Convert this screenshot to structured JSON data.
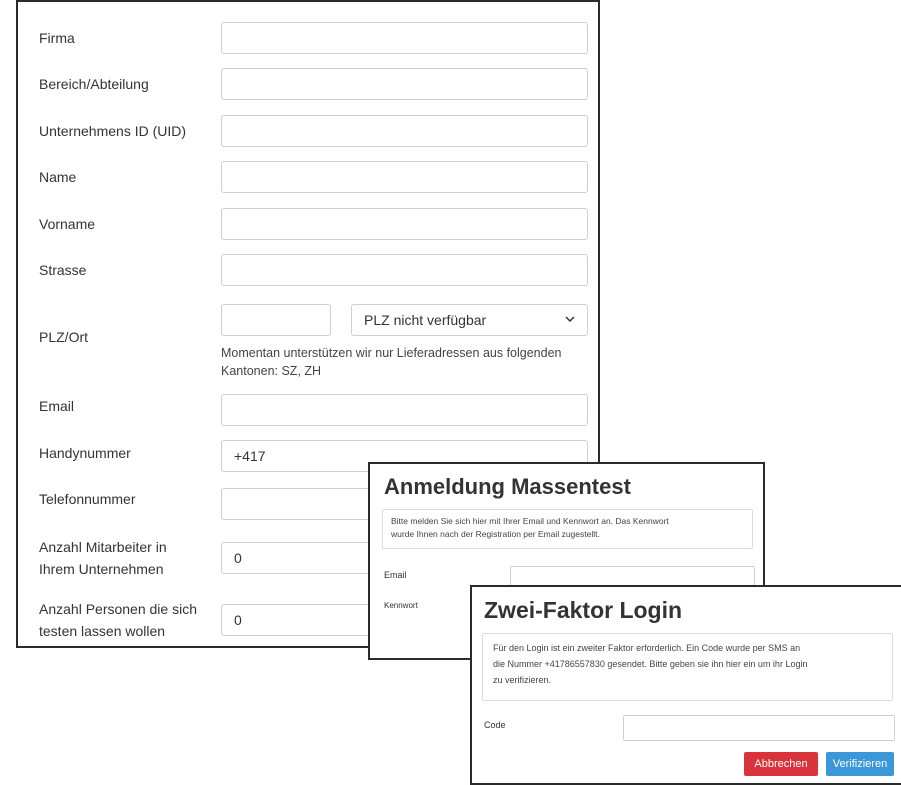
{
  "registration": {
    "fields": [
      {
        "label": "Firma",
        "value": ""
      },
      {
        "label": "Bereich/Abteilung",
        "value": ""
      },
      {
        "label": "Unternehmens ID (UID)",
        "value": ""
      },
      {
        "label": "Name",
        "value": ""
      },
      {
        "label": "Vorname",
        "value": ""
      },
      {
        "label": "Strasse",
        "value": ""
      }
    ],
    "plz_ort": {
      "label": "PLZ/Ort",
      "plz_value": "",
      "select_value": "PLZ nicht verfügbar",
      "help_line1": "Momentan unterstützen wir nur Lieferadressen aus folgenden",
      "help_line2": "Kantonen: SZ, ZH"
    },
    "email": {
      "label": "Email",
      "value": ""
    },
    "handynummer": {
      "label": "Handynummer",
      "value": "+417"
    },
    "telefonnummer": {
      "label": "Telefonnummer",
      "value": ""
    },
    "mitarbeiter": {
      "label_line1": "Anzahl Mitarbeiter in",
      "label_line2": "Ihrem Unternehmen",
      "value": "0"
    },
    "personen": {
      "label_line1": "Anzahl Personen die sich",
      "label_line2": "testen lassen wollen",
      "value": "0"
    }
  },
  "login_modal": {
    "title": "Anmeldung Massentest",
    "notice_line1": "Bitte melden Sie sich hier mit Ihrer Email und Kennwort an. Das Kennwort",
    "notice_line2": "wurde Ihnen nach der Registration per Email zugestellt.",
    "email_label": "Email",
    "password_label": "Kennwort"
  },
  "twofa_modal": {
    "title": "Zwei-Faktor Login",
    "notice_line1": "Für den Login ist ein zweiter Faktor erforderlich. Ein Code wurde per SMS an",
    "notice_line2": "die Nummer +41786557830 gesendet. Bitte geben sie ihn hier ein um ihr Login",
    "notice_line3": "zu verifizieren.",
    "code_label": "Code",
    "code_value": "",
    "cancel_label": "Abbrechen",
    "verify_label": "Verifizieren",
    "colors": {
      "cancel": "#d9343b",
      "verify": "#3b97d8"
    }
  }
}
